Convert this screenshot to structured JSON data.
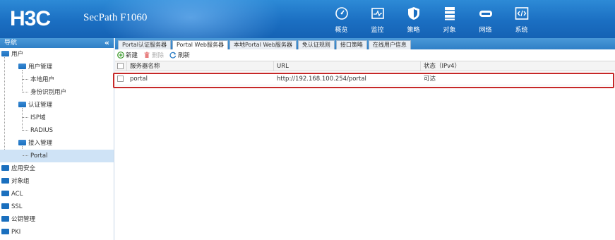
{
  "header": {
    "logo": "H3C",
    "product": "SecPath F1060",
    "nav": [
      {
        "label": "概览",
        "icon": "dashboard-icon"
      },
      {
        "label": "监控",
        "icon": "monitor-icon"
      },
      {
        "label": "策略",
        "icon": "shield-icon"
      },
      {
        "label": "对象",
        "icon": "object-list-icon"
      },
      {
        "label": "网络",
        "icon": "network-icon"
      },
      {
        "label": "系统",
        "icon": "system-code-icon"
      }
    ]
  },
  "sidebar": {
    "title": "导航",
    "collapse": "«",
    "items": [
      {
        "label": "用户",
        "level": 0,
        "type": "folder-open"
      },
      {
        "label": "用户管理",
        "level": 1,
        "type": "folder-open"
      },
      {
        "label": "本地用户",
        "level": 2,
        "type": "leaf"
      },
      {
        "label": "身份识别用户",
        "level": 2,
        "type": "leaf"
      },
      {
        "label": "认证管理",
        "level": 1,
        "type": "folder-open"
      },
      {
        "label": "ISP域",
        "level": 2,
        "type": "leaf"
      },
      {
        "label": "RADIUS",
        "level": 2,
        "type": "leaf"
      },
      {
        "label": "接入管理",
        "level": 1,
        "type": "folder-open"
      },
      {
        "label": "Portal",
        "level": 2,
        "type": "leaf",
        "selected": true
      },
      {
        "label": "应用安全",
        "level": 0,
        "type": "folder"
      },
      {
        "label": "对象组",
        "level": 0,
        "type": "folder"
      },
      {
        "label": "ACL",
        "level": 0,
        "type": "folder"
      },
      {
        "label": "SSL",
        "level": 0,
        "type": "folder"
      },
      {
        "label": "公钥管理",
        "level": 0,
        "type": "folder"
      },
      {
        "label": "PKI",
        "level": 0,
        "type": "folder"
      }
    ]
  },
  "tabs": [
    {
      "label": "Portal认证服务器",
      "active": false
    },
    {
      "label": "Portal Web服务器",
      "active": true
    },
    {
      "label": "本地Portal Web服务器",
      "active": false
    },
    {
      "label": "免认证规则",
      "active": false
    },
    {
      "label": "接口策略",
      "active": false
    },
    {
      "label": "在线用户信息",
      "active": false
    }
  ],
  "toolbar": {
    "new_label": "新建",
    "delete_label": "删除",
    "refresh_label": "刷新"
  },
  "table": {
    "columns": [
      "服务器名称",
      "URL",
      "状态（IPv4）"
    ],
    "rows": [
      {
        "name": "portal",
        "url": "http://192.168.100.254/portal",
        "status": "可达"
      }
    ]
  },
  "colors": {
    "header_blue": "#1b6fc2",
    "selected_row": "#cfe3f6",
    "highlight_red": "#c62828",
    "add_green": "#3a9a2a",
    "delete_red": "#e05050",
    "refresh_blue": "#2f7fc6"
  }
}
